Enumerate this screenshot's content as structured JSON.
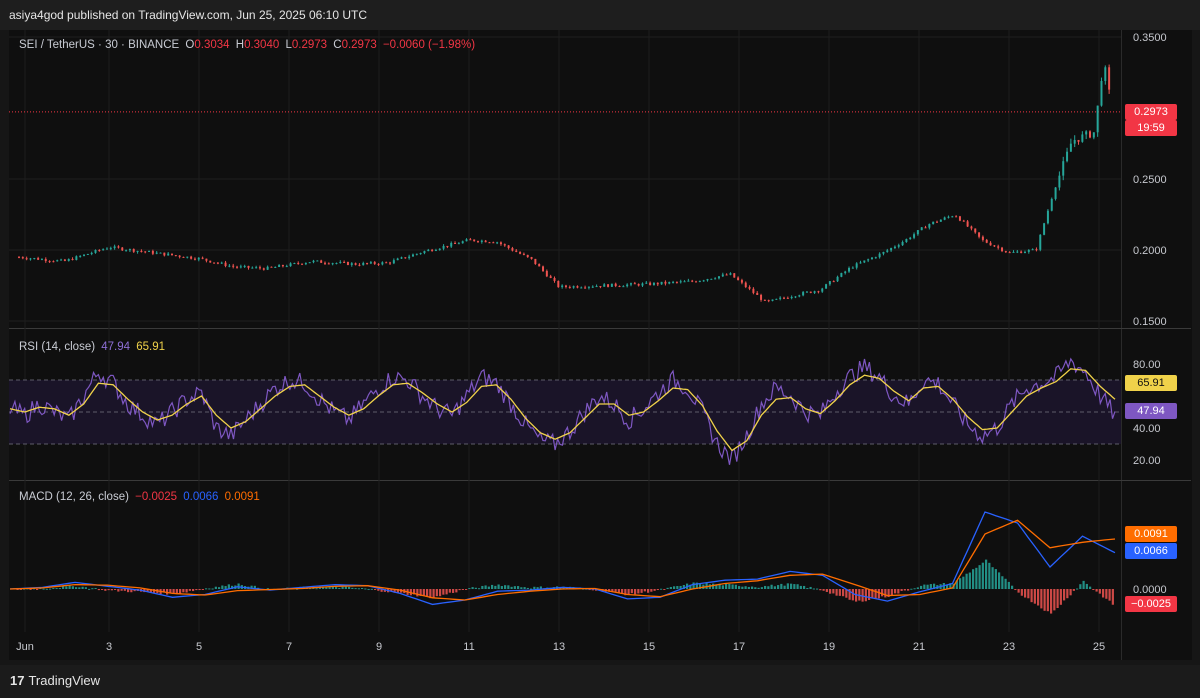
{
  "publisher": "asiya4god published on TradingView.com, Jun 25, 2025 06:10 UTC",
  "price_legend": {
    "symbol": "SEI / TetherUS · 30 · BINANCE",
    "o_label": "O",
    "o": "0.3034",
    "h_label": "H",
    "h": "0.3040",
    "l_label": "L",
    "l": "0.2973",
    "c_label": "C",
    "c": "0.2973",
    "change": "−0.0060 (−1.98%)"
  },
  "price_tag": {
    "value": "0.2973",
    "countdown": "19:59"
  },
  "rsi_legend": {
    "name": "RSI (14, close)",
    "rsi": "47.94",
    "ma": "65.91"
  },
  "macd_legend": {
    "name": "MACD (12, 26, close)",
    "hist": "−0.0025",
    "macd": "0.0066",
    "signal": "0.0091"
  },
  "footer": {
    "brand": "TradingView",
    "logo": "17"
  },
  "colors": {
    "up": "#26a69a",
    "down": "#ef5350",
    "rsi": "#7e57c2",
    "rsi_ma": "#f0d24a",
    "macd": "#2962ff",
    "signal": "#ff6d00",
    "price_line": "#f23645"
  },
  "chart_data": [
    {
      "type": "candlestick",
      "title": "SEI / TetherUS · 30 · BINANCE",
      "x_ticks": [
        "Jun",
        "3",
        "5",
        "7",
        "9",
        "11",
        "13",
        "15",
        "17",
        "19",
        "21",
        "23",
        "25"
      ],
      "y_ticks": [
        "0.3500",
        "0.2500",
        "0.2000",
        "0.1500"
      ],
      "ylim": [
        0.14,
        0.36
      ],
      "last_price": 0.2973,
      "approx_close_path": [
        {
          "d": 1.0,
          "v": 0.195
        },
        {
          "d": 2.0,
          "v": 0.192
        },
        {
          "d": 3.0,
          "v": 0.202
        },
        {
          "d": 4.0,
          "v": 0.198
        },
        {
          "d": 5.0,
          "v": 0.194
        },
        {
          "d": 5.8,
          "v": 0.188
        },
        {
          "d": 6.5,
          "v": 0.187
        },
        {
          "d": 7.5,
          "v": 0.192
        },
        {
          "d": 8.5,
          "v": 0.19
        },
        {
          "d": 9.2,
          "v": 0.191
        },
        {
          "d": 10.0,
          "v": 0.199
        },
        {
          "d": 11.0,
          "v": 0.207
        },
        {
          "d": 11.6,
          "v": 0.206
        },
        {
          "d": 12.4,
          "v": 0.193
        },
        {
          "d": 13.0,
          "v": 0.174
        },
        {
          "d": 14.0,
          "v": 0.175
        },
        {
          "d": 15.0,
          "v": 0.176
        },
        {
          "d": 16.0,
          "v": 0.178
        },
        {
          "d": 16.8,
          "v": 0.183
        },
        {
          "d": 17.6,
          "v": 0.163
        },
        {
          "d": 18.2,
          "v": 0.168
        },
        {
          "d": 18.8,
          "v": 0.172
        },
        {
          "d": 19.5,
          "v": 0.188
        },
        {
          "d": 20.2,
          "v": 0.198
        },
        {
          "d": 20.7,
          "v": 0.207
        },
        {
          "d": 21.2,
          "v": 0.218
        },
        {
          "d": 21.8,
          "v": 0.225
        },
        {
          "d": 22.4,
          "v": 0.207
        },
        {
          "d": 23.0,
          "v": 0.198
        },
        {
          "d": 23.6,
          "v": 0.2
        },
        {
          "d": 24.0,
          "v": 0.242
        },
        {
          "d": 24.4,
          "v": 0.277
        },
        {
          "d": 24.9,
          "v": 0.283
        },
        {
          "d": 25.1,
          "v": 0.333
        },
        {
          "d": 25.3,
          "v": 0.297
        }
      ]
    },
    {
      "type": "line",
      "title": "RSI (14, close)",
      "y_ticks": [
        "80.00",
        "40.00",
        "20.00"
      ],
      "ylim": [
        15,
        90
      ],
      "bands": [
        70,
        50,
        30
      ],
      "last_rsi": 47.94,
      "last_ma": 65.91,
      "series": [
        {
          "name": "RSI",
          "approx": [
            52,
            48,
            55,
            50,
            45,
            60,
            75,
            68,
            55,
            48,
            42,
            50,
            58,
            62,
            40,
            35,
            45,
            55,
            65,
            70,
            68,
            58,
            50,
            45,
            55,
            65,
            72,
            70,
            60,
            52,
            48,
            60,
            72,
            68,
            55,
            42,
            32,
            30,
            38,
            50,
            60,
            55,
            45,
            52,
            62,
            70,
            65,
            50,
            30,
            20,
            35,
            55,
            65,
            60,
            50,
            48,
            62,
            72,
            78,
            72,
            60,
            55,
            70,
            68,
            55,
            42,
            35,
            40,
            55,
            65,
            68,
            72,
            82,
            75,
            60,
            48
          ]
        },
        {
          "name": "MA",
          "approx": [
            52,
            50,
            53,
            52,
            48,
            55,
            68,
            67,
            58,
            50,
            45,
            48,
            55,
            60,
            48,
            40,
            44,
            52,
            60,
            66,
            67,
            60,
            53,
            48,
            52,
            60,
            67,
            68,
            62,
            55,
            50,
            56,
            66,
            67,
            58,
            46,
            37,
            33,
            37,
            46,
            55,
            55,
            48,
            50,
            57,
            65,
            64,
            54,
            38,
            26,
            32,
            48,
            58,
            59,
            52,
            49,
            57,
            67,
            73,
            71,
            63,
            57,
            65,
            66,
            58,
            47,
            39,
            40,
            50,
            60,
            65,
            69,
            77,
            76,
            66,
            58
          ]
        }
      ]
    },
    {
      "type": "line",
      "title": "MACD (12, 26, close)",
      "y_ticks": [
        "0.0000"
      ],
      "last_hist": -0.0025,
      "last_macd": 0.0066,
      "last_signal": 0.0091,
      "series": [
        {
          "name": "MACD",
          "approx": [
            0.0,
            0.0003,
            0.0012,
            0.0005,
            -0.0002,
            -0.0015,
            -0.001,
            0.0004,
            -0.0002,
            0.0003,
            0.0008,
            0.0006,
            -0.0008,
            -0.0028,
            -0.002,
            -0.0004,
            -0.0002,
            0.0003,
            0.0,
            -0.0018,
            -0.0015,
            0.0008,
            0.0016,
            0.0018,
            0.0032,
            0.0025,
            -0.001,
            -0.0022,
            -0.0005,
            0.001,
            0.014,
            0.012,
            0.004,
            0.0096,
            0.0066
          ]
        },
        {
          "name": "Signal",
          "approx": [
            0.0,
            0.0002,
            0.0008,
            0.0007,
            0.0002,
            -0.0008,
            -0.0011,
            -0.0003,
            -0.0001,
            0.0001,
            0.0005,
            0.0006,
            -0.0002,
            -0.0016,
            -0.002,
            -0.001,
            -0.0004,
            0.0,
            0.0001,
            -0.001,
            -0.0014,
            0.0,
            0.001,
            0.0015,
            0.0025,
            0.0027,
            0.0008,
            -0.0012,
            -0.001,
            0.0002,
            0.01,
            0.0125,
            0.0075,
            0.0085,
            0.0091
          ]
        }
      ]
    }
  ]
}
